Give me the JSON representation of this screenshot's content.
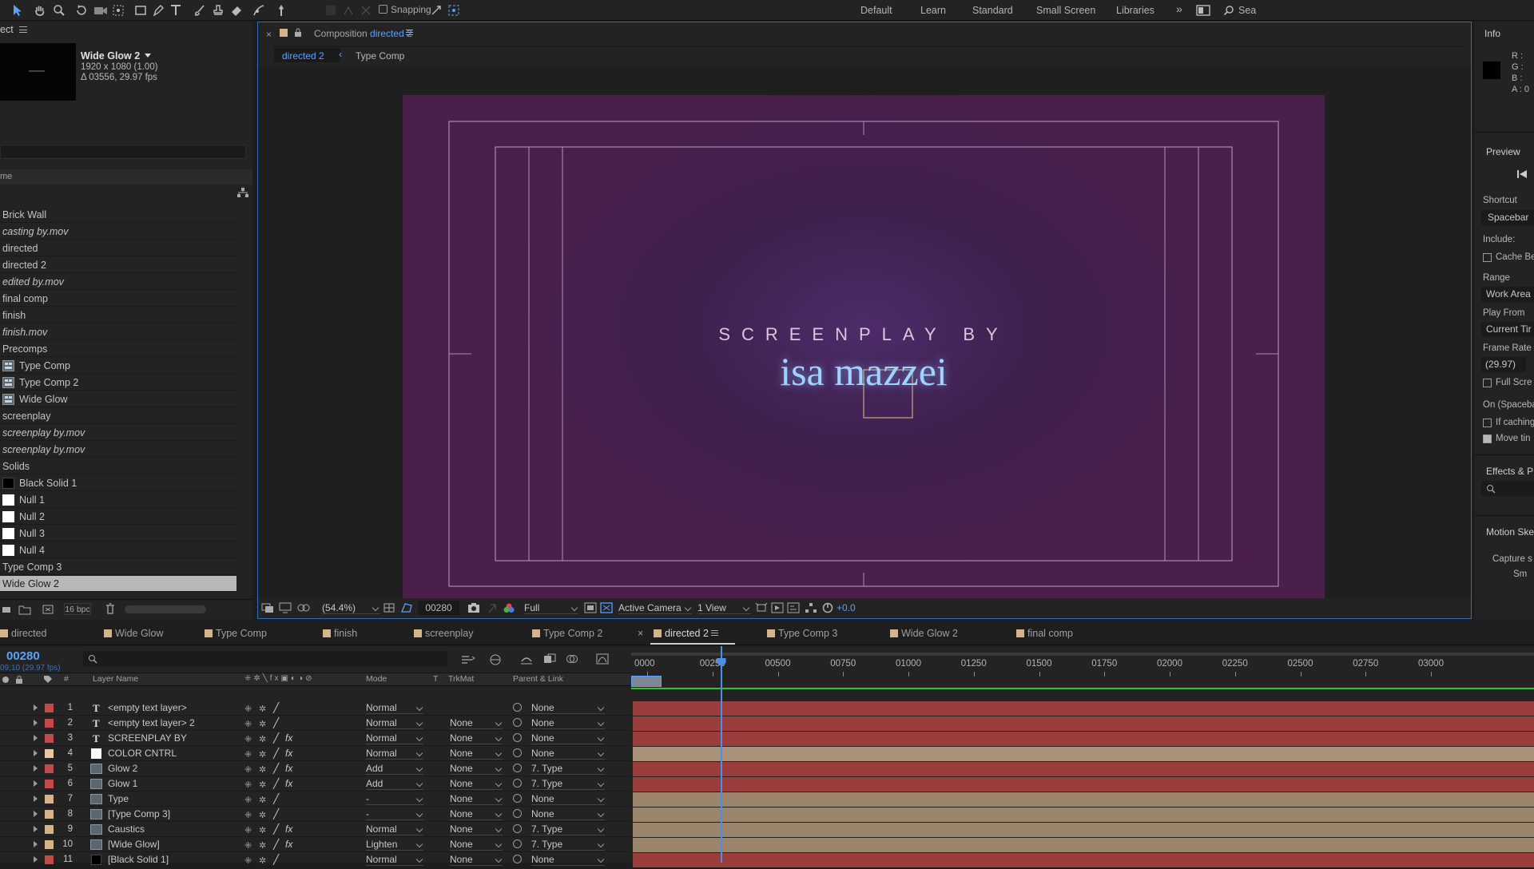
{
  "toolbar": {
    "snapping_label": "Snapping",
    "workspaces": [
      "Default",
      "Learn",
      "Standard",
      "Small Screen",
      "Libraries"
    ],
    "search_label": "Sea"
  },
  "project_panel": {
    "title_label": "ect",
    "selected_item": {
      "name": "Wide Glow 2",
      "dimensions": "1920 x 1080 (1.00)",
      "duration": "Δ 03556, 29.97 fps"
    },
    "column_header": "me",
    "items": [
      {
        "label": "Brick Wall",
        "italic": false,
        "icon": ""
      },
      {
        "label": "casting by.mov",
        "italic": true,
        "icon": ""
      },
      {
        "label": "directed",
        "italic": false,
        "icon": ""
      },
      {
        "label": "directed 2",
        "italic": false,
        "icon": ""
      },
      {
        "label": "edited by.mov",
        "italic": true,
        "icon": ""
      },
      {
        "label": "final comp",
        "italic": false,
        "icon": ""
      },
      {
        "label": "finish",
        "italic": false,
        "icon": ""
      },
      {
        "label": "finish.mov",
        "italic": true,
        "icon": ""
      },
      {
        "label": "Precomps",
        "italic": false,
        "icon": ""
      },
      {
        "label": "Type Comp",
        "italic": false,
        "icon": "comp-icon"
      },
      {
        "label": "Type Comp 2",
        "italic": false,
        "icon": "comp-icon"
      },
      {
        "label": "Wide Glow",
        "italic": false,
        "icon": "comp-icon"
      },
      {
        "label": "screenplay",
        "italic": false,
        "icon": ""
      },
      {
        "label": "screenplay by.mov",
        "italic": true,
        "icon": ""
      },
      {
        "label": "screenplay by.mov",
        "italic": true,
        "icon": ""
      },
      {
        "label": "Solids",
        "italic": false,
        "icon": ""
      },
      {
        "label": "Black Solid 1",
        "italic": false,
        "icon": "black-solid-icon"
      },
      {
        "label": "Null 1",
        "italic": false,
        "icon": "white-solid-icon"
      },
      {
        "label": "Null 2",
        "italic": false,
        "icon": "white-solid-icon"
      },
      {
        "label": "Null 3",
        "italic": false,
        "icon": "white-solid-icon"
      },
      {
        "label": "Null 4",
        "italic": false,
        "icon": "white-solid-icon"
      },
      {
        "label": "Type Comp 3",
        "italic": false,
        "icon": ""
      },
      {
        "label": "Wide Glow 2",
        "italic": false,
        "icon": "",
        "selected": true
      }
    ],
    "bpc_label": "16 bpc"
  },
  "composition_panel": {
    "header_prefix": "Composition",
    "header_name": "directed 2",
    "breadcrumbs": [
      "directed 2",
      "Type Comp"
    ],
    "canvas": {
      "line1": "SCREENPLAY BY",
      "line2": "isa mazzei",
      "bg_color": "#4a1f4a",
      "accent_color": "#9fd2ff"
    },
    "footer": {
      "zoom": "(54.4%)",
      "timecode": "00280",
      "resolution": "Full",
      "camera": "Active Camera",
      "views": "1 View",
      "exposure": "+0.0"
    }
  },
  "info_panel": {
    "title": "Info",
    "channels": [
      "R :",
      "G :",
      "B :",
      "A : 0"
    ],
    "preview_title": "Preview",
    "shortcut_label": "Shortcut",
    "shortcut_value": "Spacebar",
    "include_label": "Include:",
    "cache_label": "Cache Be",
    "range_label": "Range",
    "range_value": "Work Area",
    "play_from_label": "Play From",
    "play_from_value": "Current Tir",
    "frame_rate_label": "Frame Rate",
    "frame_rate_value": "(29.97)",
    "full_screen_label": "Full Scre",
    "on_label": "On (Spaceba",
    "if_caching_label": "If caching",
    "move_label": "Move tin",
    "effects_label": "Effects & P",
    "motion_label": "Motion Ske",
    "capture_label": "Capture s",
    "sm_label": "Sm"
  },
  "timeline_tabs": [
    {
      "label": "directed",
      "color": "#d5b48a",
      "active": false
    },
    {
      "label": "Wide Glow",
      "color": "#d5b48a",
      "active": false
    },
    {
      "label": "Type Comp",
      "color": "#d5b48a",
      "active": false
    },
    {
      "label": "finish",
      "color": "#d5b48a",
      "active": false
    },
    {
      "label": "screenplay",
      "color": "#d5b48a",
      "active": false
    },
    {
      "label": "Type Comp 2",
      "color": "#d5b48a",
      "active": false
    },
    {
      "label": "directed 2",
      "color": "#d5b48a",
      "active": true
    },
    {
      "label": "Type Comp 3",
      "color": "#d5b48a",
      "active": false
    },
    {
      "label": "Wide Glow 2",
      "color": "#d5b48a",
      "active": false
    },
    {
      "label": "final comp",
      "color": "#d5b48a",
      "active": false
    }
  ],
  "timeline": {
    "timecode": "00280",
    "fps_label": "09;10 (29.97 fps)",
    "columns": {
      "layer_name": "Layer Name",
      "mode": "Mode",
      "t": "T",
      "trkmat": "TrkMat",
      "parent": "Parent & Link"
    },
    "ruler_labels": [
      "0000",
      "00250",
      "00500",
      "00750",
      "01000",
      "01250",
      "01500",
      "01750",
      "02000",
      "02250",
      "02500",
      "02750",
      "03000"
    ],
    "current_frame": 280,
    "ruler_start": 0,
    "ruler_end": 3000,
    "layers": [
      {
        "num": "1",
        "name": "<empty text layer>",
        "type": "T",
        "color": "#c14a4a",
        "fx": false,
        "mode": "Normal",
        "trkmat": "",
        "parent": "None",
        "bar_color": "#9a3d3d"
      },
      {
        "num": "2",
        "name": "<empty text layer> 2",
        "type": "T",
        "color": "#c14a4a",
        "fx": false,
        "mode": "Normal",
        "trkmat": "None",
        "parent": "None",
        "bar_color": "#9a3d3d"
      },
      {
        "num": "3",
        "name": "SCREENPLAY BY",
        "type": "T",
        "color": "#c14a4a",
        "fx": true,
        "mode": "Normal",
        "trkmat": "None",
        "parent": "None",
        "bar_color": "#9a3d3d"
      },
      {
        "num": "4",
        "name": "COLOR CNTRL",
        "type": "solid",
        "color": "#e8c8a4",
        "fx": true,
        "mode": "Normal",
        "trkmat": "None",
        "parent": "None",
        "bar_color": "#a8927a"
      },
      {
        "num": "5",
        "name": "Glow 2",
        "type": "comp",
        "color": "#c14a4a",
        "fx": true,
        "mode": "Add",
        "trkmat": "None",
        "parent": "7. Type",
        "bar_color": "#9a3d3d"
      },
      {
        "num": "6",
        "name": "Glow 1",
        "type": "comp",
        "color": "#c14a4a",
        "fx": true,
        "mode": "Add",
        "trkmat": "None",
        "parent": "7. Type",
        "bar_color": "#9a3d3d"
      },
      {
        "num": "7",
        "name": "Type",
        "type": "comp",
        "color": "#d5b48a",
        "fx": false,
        "mode": "-",
        "trkmat": "None",
        "parent": "None",
        "bar_color": "#9a846c"
      },
      {
        "num": "8",
        "name": "[Type Comp 3]",
        "type": "comp",
        "color": "#d5b48a",
        "fx": false,
        "mode": "-",
        "trkmat": "None",
        "parent": "None",
        "bar_color": "#9a846c"
      },
      {
        "num": "9",
        "name": "Caustics",
        "type": "comp",
        "color": "#d5b48a",
        "fx": true,
        "mode": "Normal",
        "trkmat": "None",
        "parent": "7. Type",
        "bar_color": "#9a846c"
      },
      {
        "num": "10",
        "name": "[Wide Glow]",
        "type": "comp",
        "color": "#d5b48a",
        "fx": true,
        "mode": "Lighten",
        "trkmat": "None",
        "parent": "7. Type",
        "bar_color": "#9a846c"
      },
      {
        "num": "11",
        "name": "[Black Solid 1]",
        "type": "solid-black",
        "color": "#c14a4a",
        "fx": false,
        "mode": "Normal",
        "trkmat": "None",
        "parent": "None",
        "bar_color": "#9a3d3d"
      }
    ]
  }
}
